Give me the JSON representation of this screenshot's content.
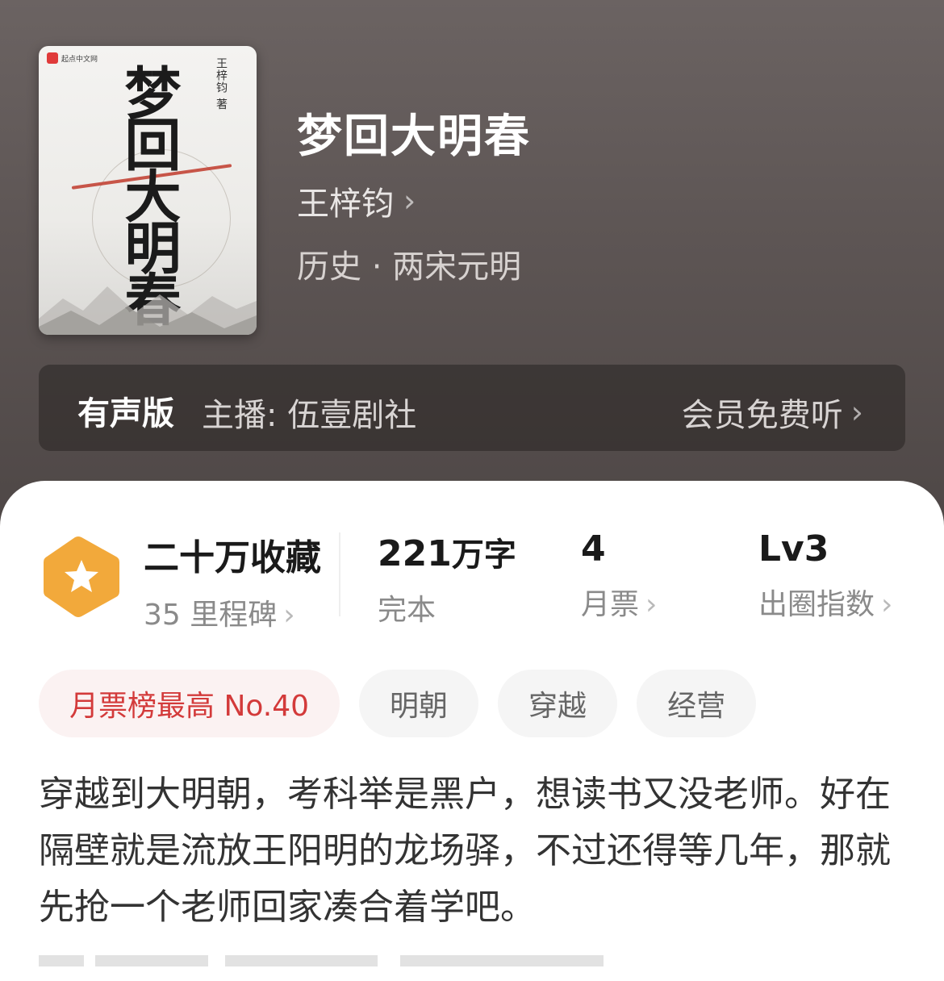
{
  "cover": {
    "publisher": "起点中文网",
    "title_art": "梦回大明春",
    "author_art": "王梓钧 著"
  },
  "book": {
    "title": "梦回大明春",
    "author": "王梓钧",
    "category": "历史 · 两宋元明"
  },
  "audio": {
    "tag": "有声版",
    "host": "主播: 伍壹剧社",
    "cta": "会员免费听"
  },
  "stats": {
    "collection": {
      "value": "二十万收藏",
      "sub": "35 里程碑"
    },
    "words": {
      "value": "221",
      "unit": "万字",
      "sub": "完本"
    },
    "tickets": {
      "value": "4",
      "sub": "月票"
    },
    "index": {
      "value": "Lv3",
      "sub": "出圈指数"
    }
  },
  "tags": [
    "月票榜最高 No.40",
    "明朝",
    "穿越",
    "经营"
  ],
  "intro": "穿越到大明朝，考科举是黑户，想读书又没老师。好在隔壁就是流放王阳明的龙场驿，不过还得等几年，那就先抢一个老师回家凑合着学吧。",
  "colors": {
    "badge": "#f2a93b",
    "hot_tag": "#d33a3a"
  }
}
